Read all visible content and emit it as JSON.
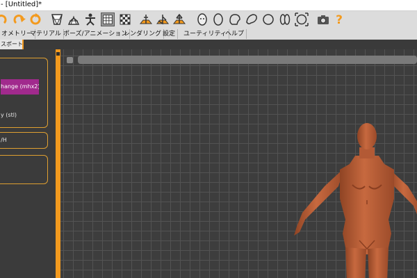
{
  "window": {
    "title": "- [Untitled]*"
  },
  "toolbar": {
    "icons": [
      "undo-icon",
      "redo-icon",
      "reset-icon",
      "wireframe-icon",
      "background-icon",
      "pose-icon",
      "grid-icon",
      "checker-icon",
      "front-view-icon",
      "side-view-icon",
      "top-view-icon",
      "face-icon",
      "head-icon",
      "body-icon",
      "hand-icon",
      "sphere-icon",
      "legs-icon",
      "frame-icon",
      "camera-icon",
      "help-icon"
    ],
    "colors": {
      "orange": "#f39a1e",
      "active": "#9a9a9a"
    }
  },
  "menu": {
    "items": [
      "オメトリー",
      "マテリアル",
      "ポーズ/アニメーション",
      "レンダリング",
      "設定",
      "ユーティリティ",
      "ヘルプ"
    ]
  },
  "subtab": {
    "active_label": "スポート"
  },
  "left_panel": {
    "highlight": "hange (mhx2)",
    "stl": "y (stl)",
    "item": "/H",
    "highlight_color": "#a12a8d",
    "border_color": "#e0a030"
  },
  "viewport": {
    "bg": "#3d3d3d",
    "grid": "#535353",
    "skin": "#c2643d"
  }
}
